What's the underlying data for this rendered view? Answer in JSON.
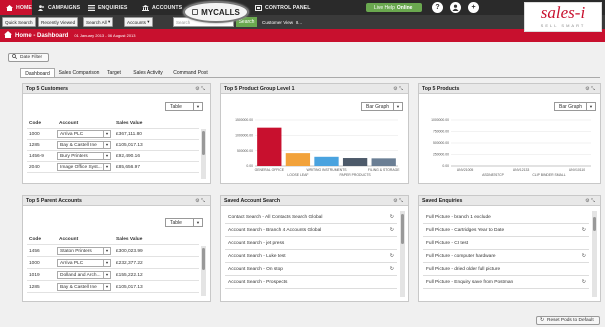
{
  "nav": {
    "home": "HOME",
    "campaigns": "CAMPAIGNS",
    "enquiries": "ENQUIRIES",
    "accounts": "ACCOUNTS",
    "mycalls": "MYCALLS",
    "control_panel": "CONTROL PANEL",
    "live_help": "Live Help",
    "live_status": "Online",
    "icons": [
      "help-icon",
      "user-icon",
      "add-icon"
    ]
  },
  "logo": {
    "main": "sales-i",
    "sub": "SELL SMART"
  },
  "searchbar": {
    "quick_search": "Quick Search",
    "recently_viewed": "Recently Viewed",
    "search_all": "Search All",
    "accounts": "Accounts",
    "input_placeholder": "Search",
    "search_button": "Search",
    "customer_view": "Customer View",
    "customer_view_suffix": "II..."
  },
  "header": {
    "title": "Home - Dashboard",
    "date_range": "01 January 2013 - 06 August 2013"
  },
  "date_filter": "Date Filter",
  "tabs": [
    "Dashboard",
    "Sales Comparison",
    "Target",
    "Sales Activity",
    "Command Post"
  ],
  "panels": {
    "top_customers": {
      "title": "Top 5 Customers",
      "view": "Table",
      "columns": [
        "Code",
        "Account",
        "Sales Value"
      ],
      "rows": [
        {
          "code": "1000",
          "account": "Arriva PLC",
          "value": "£367,111.80"
        },
        {
          "code": "1285",
          "account": "Bay & Castell Ine",
          "value": "£105,017.13"
        },
        {
          "code": "1456-9",
          "account": "Bury Printers",
          "value": "£92,490.16"
        },
        {
          "code": "2040",
          "account": "Image Office Syst...",
          "value": "£85,656.97"
        }
      ]
    },
    "top_product_group": {
      "title": "Top 5 Product Group Level 1",
      "view": "Bar Graph",
      "chart_data": {
        "type": "bar",
        "categories": [
          "GENERAL OFFICE",
          "LOOSE LEAF",
          "WRITING INSTRUMENTS",
          "PAPER PRODUCTS",
          "FILING & STORAGE"
        ],
        "values": [
          1250000,
          420000,
          300000,
          260000,
          250000
        ],
        "colors": [
          "#c8102e",
          "#f2a23a",
          "#4aa3df",
          "#4d5a6a",
          "#6b7f95"
        ],
        "ylim": [
          0,
          1500000
        ],
        "yticks": [
          "1500000.00",
          "1000000.00",
          "500000.00",
          "0.00"
        ]
      }
    },
    "top_products": {
      "title": "Top 5 Products",
      "view": "Bar Graph",
      "chart_data": {
        "type": "bar",
        "categories": [
          "UNV21005",
          "ASDN8767CP",
          "UNV12133",
          "CLIP BINDER SMALL",
          "UNV10110"
        ],
        "values": [
          0,
          0,
          0,
          0,
          0
        ],
        "ylim": [
          0,
          1000000
        ],
        "yticks": [
          "1000000.00",
          "750000.00",
          "500000.00",
          "250000.00",
          "0.00"
        ]
      }
    },
    "top_parent_accounts": {
      "title": "Top 5 Parent Accounts",
      "view": "Table",
      "columns": [
        "Code",
        "Account",
        "Sales Value"
      ],
      "rows": [
        {
          "code": "1456",
          "account": "Staton Printers",
          "value": "£300,023.99"
        },
        {
          "code": "1000",
          "account": "Arriva PLC",
          "value": "£232,377.22"
        },
        {
          "code": "1019",
          "account": "Dolland and Arch...",
          "value": "£155,222.12"
        },
        {
          "code": "1285",
          "account": "Bay & Castell Ine",
          "value": "£105,017.13"
        }
      ]
    },
    "saved_account_search": {
      "title": "Saved Account Search",
      "items": [
        "Contact Search - All Contacts Search Global",
        "Account Search - Branch 4 Accounts Global",
        "Account Search - jet press",
        "Account Search - Luke test",
        "Account Search - On stop",
        "Account Search - Prospects"
      ]
    },
    "saved_enquiries": {
      "title": "Saved Enquiries",
      "items": [
        "Full Picture - branch 1 exclude",
        "Full Picture - Cartridges Year to Date",
        "Full Picture - CI test",
        "Full Picture - computer hardware",
        "Full Picture - dried older full picture",
        "Full Picture - Enquiry save from Postman"
      ]
    }
  },
  "reset_pods": "Reset Pods to Default"
}
